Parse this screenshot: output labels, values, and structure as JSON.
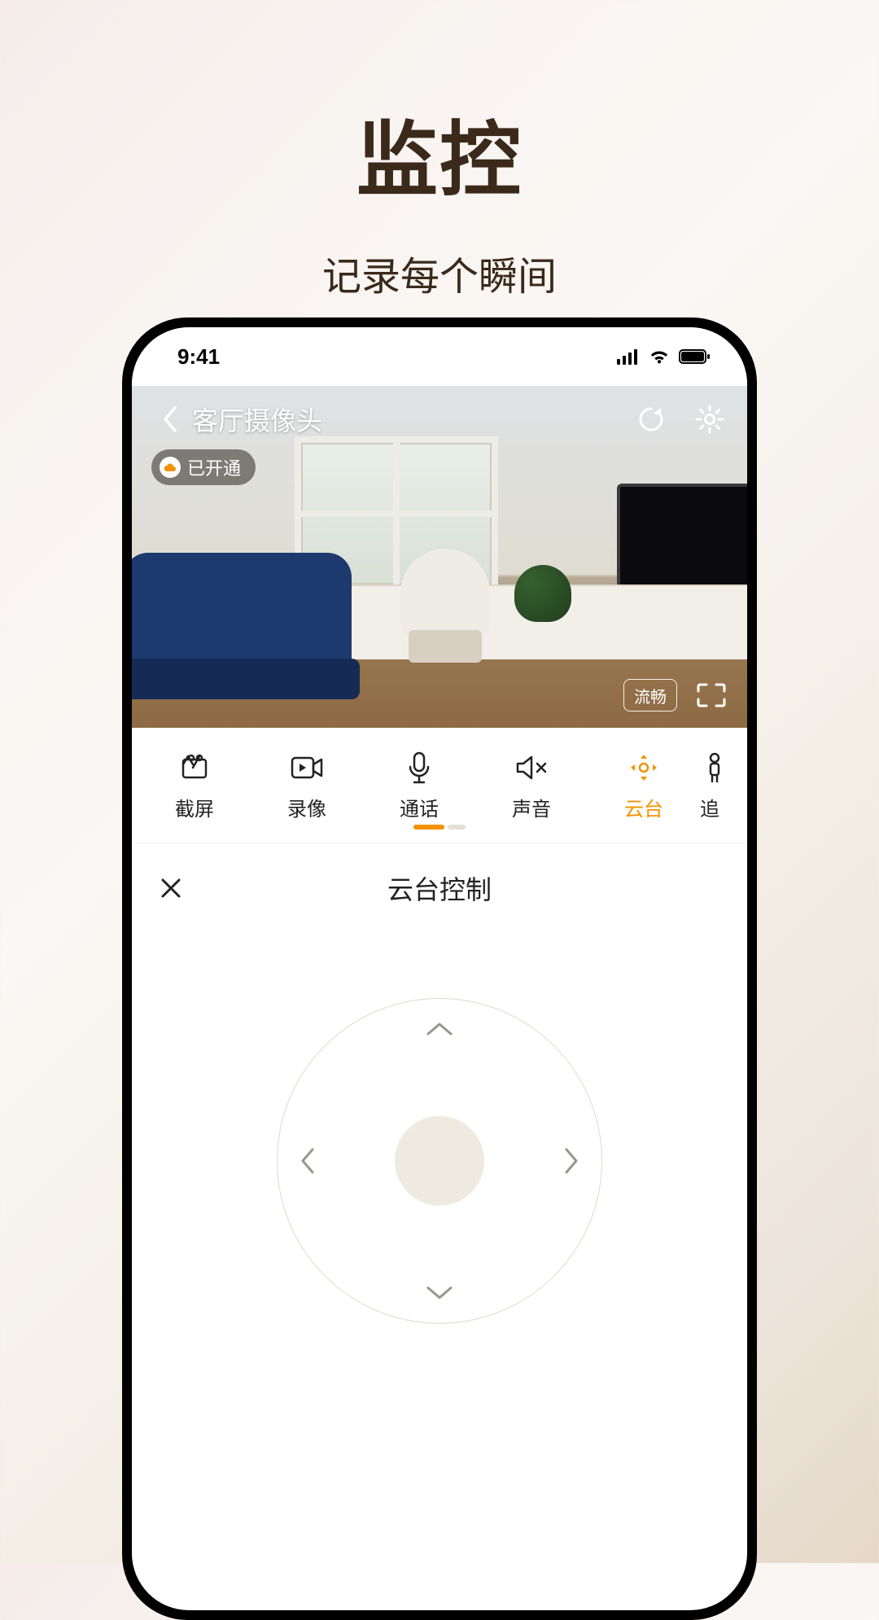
{
  "marketing": {
    "title": "监控",
    "subtitle": "记录每个瞬间"
  },
  "status": {
    "time": "9:41"
  },
  "camera": {
    "name": "客厅摄像头",
    "cloud_status": "已开通",
    "quality": "流畅",
    "icons": {
      "back": "back-icon",
      "refresh": "refresh-icon",
      "settings": "gear-icon",
      "cloud": "cloud-icon",
      "fullscreen": "fullscreen-icon"
    }
  },
  "actions": {
    "items": [
      {
        "label": "截屏",
        "icon": "screenshot-icon"
      },
      {
        "label": "录像",
        "icon": "record-icon"
      },
      {
        "label": "通话",
        "icon": "mic-icon"
      },
      {
        "label": "声音",
        "icon": "speaker-mute-icon"
      },
      {
        "label": "云台",
        "icon": "ptz-icon",
        "active": true
      },
      {
        "label": "追",
        "icon": "track-icon"
      }
    ]
  },
  "ptz": {
    "title": "云台控制"
  }
}
